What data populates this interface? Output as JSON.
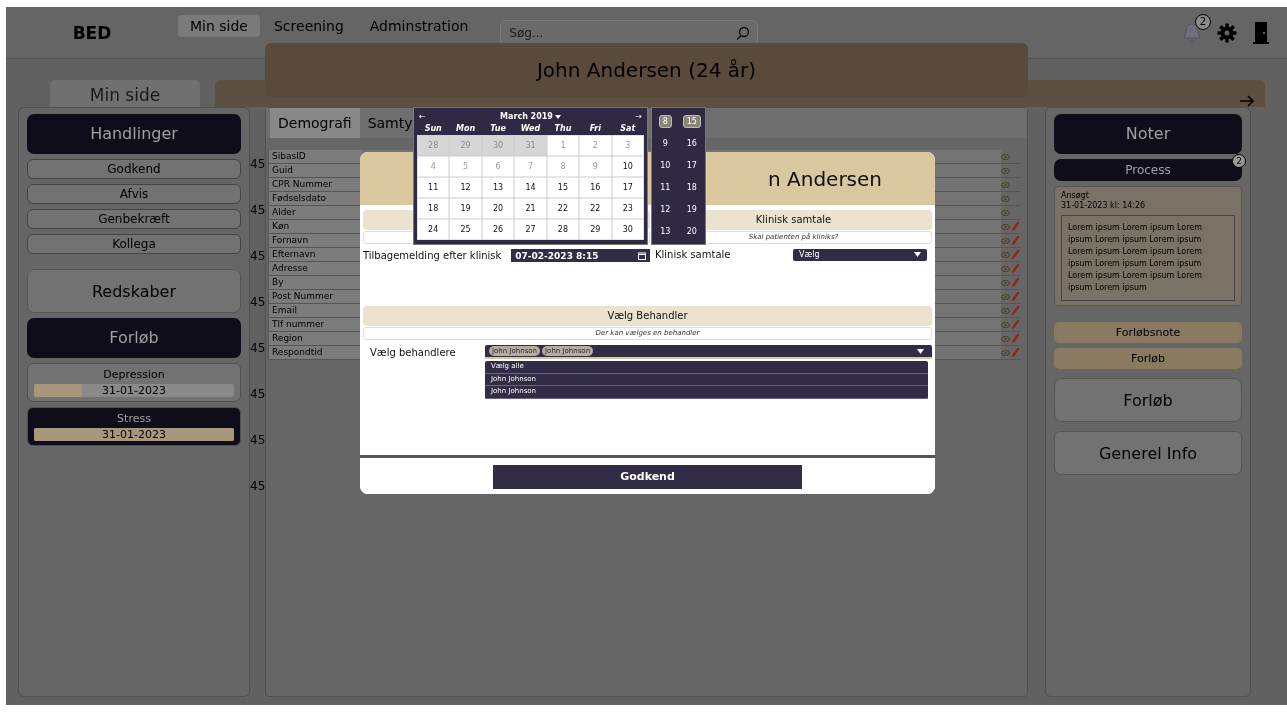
{
  "topbar": {
    "logo": "BED",
    "nav": [
      {
        "label": "Min side",
        "selected": true
      },
      {
        "label": "Screening",
        "selected": false
      },
      {
        "label": "Adminstration",
        "selected": false
      }
    ],
    "search": {
      "placeholder": "Søg..."
    },
    "notification_badge": "2"
  },
  "page_tab": {
    "label": "Min side"
  },
  "left_panel": {
    "header": "Handlinger",
    "actions": [
      "Godkend",
      "Afvis",
      "Genbekræft",
      "Kollega"
    ],
    "tools": "Redskaber",
    "courses_header": "Forløb",
    "courses": [
      {
        "name": "Depression",
        "date": "31-01-2023",
        "level": 0.24,
        "selected": false
      },
      {
        "name": "Stress",
        "date": "31-01-2023",
        "level": 1,
        "selected": true
      }
    ]
  },
  "row_values": [
    "45",
    "45",
    "45",
    "45",
    "45",
    "45",
    "45",
    "45"
  ],
  "patient": {
    "title": "John Andersen (24 år)",
    "tabs": [
      {
        "label": "Demografi",
        "selected": true
      },
      {
        "label": "Samty",
        "selected": false
      }
    ],
    "fields": [
      {
        "label": "SibasID",
        "editable": false
      },
      {
        "label": "Guid",
        "editable": false
      },
      {
        "label": "CPR Nummer",
        "editable": false
      },
      {
        "label": "Fødselsdato",
        "editable": false
      },
      {
        "label": "Alder",
        "editable": false
      },
      {
        "label": "Køn",
        "editable": true
      },
      {
        "label": "Fornavn",
        "editable": true
      },
      {
        "label": "Efternavn",
        "editable": true
      },
      {
        "label": "Adresse",
        "editable": true
      },
      {
        "label": "By",
        "editable": true
      },
      {
        "label": "Post Nummer",
        "editable": true
      },
      {
        "label": "Email",
        "editable": true
      },
      {
        "label": "Tlf nummer",
        "editable": true
      },
      {
        "label": "Region",
        "editable": true
      },
      {
        "label": "Respondtid",
        "editable": true
      }
    ]
  },
  "right_panel": {
    "header": "Noter",
    "process": {
      "label": "Process",
      "badge": "2"
    },
    "note": {
      "status": "Ansøgt",
      "timestamp": "31-01-2023 kl: 14:26",
      "text": "Lorem ipsum Lorem ipsum Lorem ipsum Lorem ipsum Lorem ipsum Lorem ipsum Lorem ipsum Lorem ipsum Lorem ipsum Lorem ipsum Lorem ipsum Lorem ipsum Lorem ipsum Lorem ipsum"
    },
    "tags": [
      "Forløbsnote",
      "Forløb"
    ],
    "buttons": [
      "Forløb",
      "Generel Info"
    ]
  },
  "modal": {
    "title": "n Andersen",
    "clinical": {
      "header": "Klinisk samtale",
      "hint": "Skal patienten på kliniks?"
    },
    "feedback": {
      "label": "Tilbagemelding efter klinisk",
      "value": "07-02-2023 8:15"
    },
    "clinical_select": {
      "label": "Klinisk samtale",
      "value": "Vælg"
    },
    "therapist": {
      "header": "Vælg Behandler",
      "hint": "Der kan vælges en behandler",
      "label": "Vælg behandlere",
      "chips": [
        "John Johnson",
        "John Johnson"
      ],
      "expanded": true,
      "options": [
        "Vælg alle",
        "John Johnson",
        "John Johnson"
      ]
    },
    "submit": "Godkend"
  },
  "calendar": {
    "prev": "←",
    "month": "March 2019",
    "next": "→",
    "weekdays": [
      "Sun",
      "Mon",
      "Tue",
      "Wed",
      "Thu",
      "Fri",
      "Sat"
    ],
    "weeks": [
      [
        {
          "day": "28",
          "kind": "outside"
        },
        {
          "day": "29",
          "kind": "outside"
        },
        {
          "day": "30",
          "kind": "outside"
        },
        {
          "day": "31",
          "kind": "outside"
        },
        {
          "day": "1",
          "kind": "disabled"
        },
        {
          "day": "2",
          "kind": "disabled"
        },
        {
          "day": "3",
          "kind": "disabled"
        }
      ],
      [
        {
          "day": "4",
          "kind": "disabled"
        },
        {
          "day": "5",
          "kind": "disabled"
        },
        {
          "day": "6",
          "kind": "disabled"
        },
        {
          "day": "7",
          "kind": "disabled"
        },
        {
          "day": "8",
          "kind": "disabled"
        },
        {
          "day": "9",
          "kind": "disabled"
        },
        {
          "day": "10",
          "kind": "normal"
        }
      ],
      [
        {
          "day": "11",
          "kind": "normal"
        },
        {
          "day": "12",
          "kind": "normal"
        },
        {
          "day": "13",
          "kind": "normal"
        },
        {
          "day": "14",
          "kind": "normal"
        },
        {
          "day": "15",
          "kind": "normal"
        },
        {
          "day": "16",
          "kind": "normal"
        },
        {
          "day": "17",
          "kind": "normal"
        }
      ],
      [
        {
          "day": "18",
          "kind": "normal"
        },
        {
          "day": "19",
          "kind": "normal"
        },
        {
          "day": "20",
          "kind": "normal"
        },
        {
          "day": "21",
          "kind": "normal"
        },
        {
          "day": "22",
          "kind": "normal"
        },
        {
          "day": "22",
          "kind": "normal"
        },
        {
          "day": "23",
          "kind": "normal"
        }
      ],
      [
        {
          "day": "24",
          "kind": "normal"
        },
        {
          "day": "25",
          "kind": "normal"
        },
        {
          "day": "26",
          "kind": "normal"
        },
        {
          "day": "27",
          "kind": "normal"
        },
        {
          "day": "28",
          "kind": "normal"
        },
        {
          "day": "29",
          "kind": "normal"
        },
        {
          "day": "30",
          "kind": "normal"
        }
      ]
    ],
    "times": [
      [
        {
          "label": "8",
          "selected": true
        },
        {
          "label": "15",
          "selected": true
        }
      ],
      [
        {
          "label": "9",
          "selected": false
        },
        {
          "label": "16",
          "selected": false
        }
      ],
      [
        {
          "label": "10",
          "selected": false
        },
        {
          "label": "17",
          "selected": false
        }
      ],
      [
        {
          "label": "11",
          "selected": false
        },
        {
          "label": "18",
          "selected": false
        }
      ],
      [
        {
          "label": "12",
          "selected": false
        },
        {
          "label": "19",
          "selected": false
        }
      ],
      [
        {
          "label": "13",
          "selected": false
        },
        {
          "label": "20",
          "selected": false
        }
      ]
    ]
  }
}
